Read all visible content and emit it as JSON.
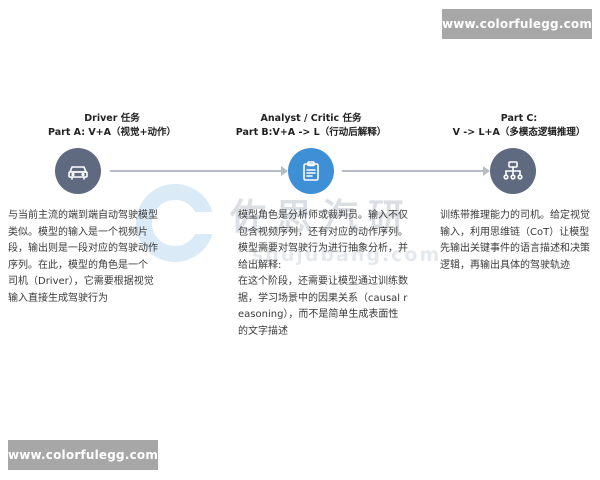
{
  "watermarks": {
    "top": "www.colorfulegg.com",
    "bottom": "www.colorfulegg.com"
  },
  "background_logo": {
    "chinese": "佐思汽研",
    "latin": "shujubang.com"
  },
  "stages": [
    {
      "title_line1": "Driver 任务",
      "title_line2": "Part A: V+A（视觉+动作）",
      "icon": "car-icon",
      "icon_color": "#5f6a80",
      "description": [
        "与当前主流的端到端自动驾驶模型类似。模型的输入是一个视频片段，输出则是一段对应的驾驶动作序列。在此，模型的角色是一个 司机（Driver），它需要根据视觉输入直接生成驾驶行为"
      ]
    },
    {
      "title_line1": "Analyst / Critic 任务",
      "title_line2": "Part B:V+A -> L（行动后解释）",
      "icon": "clipboard-icon",
      "icon_color": "#3f8fd6",
      "description": [
        "模型角色是分析师或裁判员。输入不仅包含视频序列，还有对应的动作序列。模型需要对驾驶行为进行抽象分析，并给出解释:",
        "在这个阶段，还需要让模型通过训练数据，学习场景中的因果关系（causal reasoning），而不是简单生成表面性的文字描述"
      ]
    },
    {
      "title_line1": "Part C:",
      "title_line2": "V -> L+A（多模态逻辑推理）",
      "icon": "flowchart-icon",
      "icon_color": "#5f6a80",
      "description": [
        "训练带推理能力的司机。给定视觉输入，利用思维链（CoT）让模型先输出关键事件的语言描述和决策逻辑，再输出具体的驾驶轨迹"
      ]
    }
  ]
}
